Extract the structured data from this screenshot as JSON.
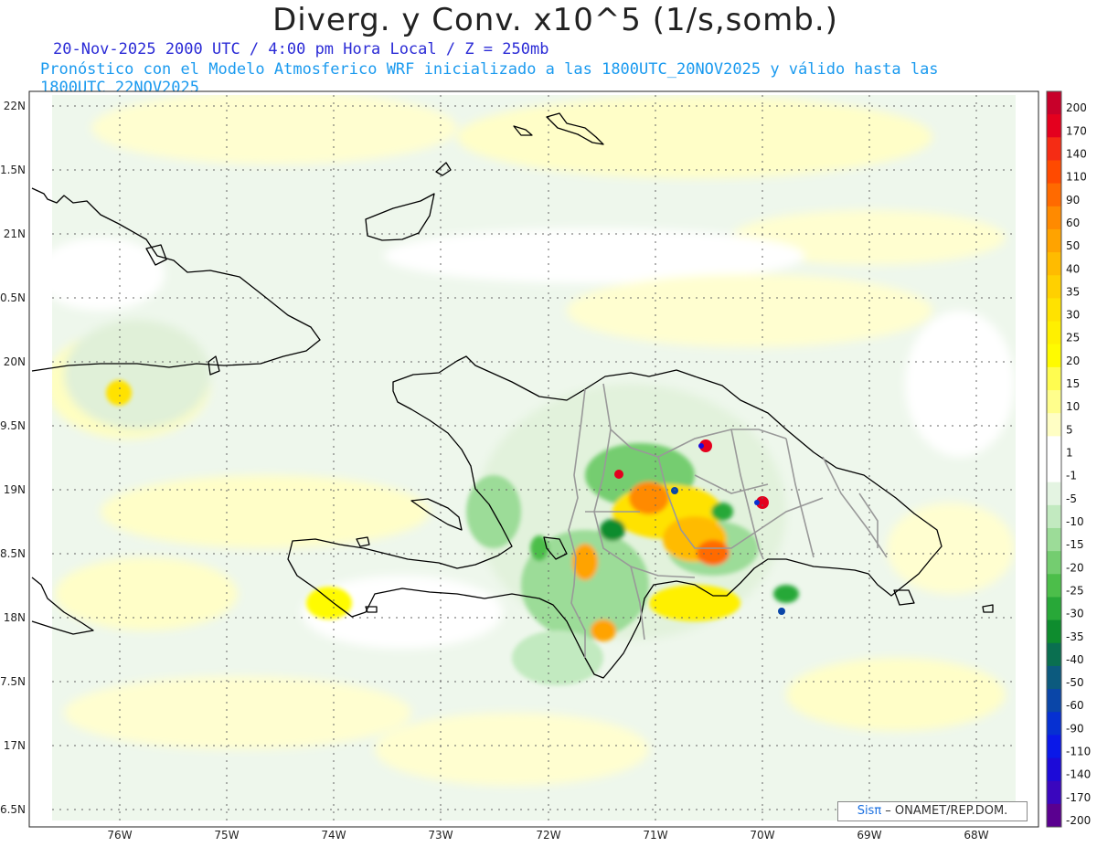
{
  "header": {
    "title": "Diverg. y Conv. x10^5 (1/s,somb.)",
    "subtitle": "20-Nov-2025  2000 UTC / 4:00 pm Hora Local / Z = 250mb",
    "description": "Pronóstico con el Modelo Atmosferico WRF inicializado a las 1800UTC_20NOV2025 y válido hasta las  1800UTC_22NOV2025"
  },
  "axes": {
    "lat_labels": [
      "22N",
      "1.5N",
      "21N",
      "0.5N",
      "20N",
      "9.5N",
      "19N",
      "8.5N",
      "18N",
      "7.5N",
      "17N",
      "6.5N"
    ],
    "lon_labels": [
      "76W",
      "75W",
      "74W",
      "73W",
      "72W",
      "71W",
      "70W",
      "69W",
      "68W"
    ]
  },
  "colorbar": {
    "labels": [
      "200",
      "170",
      "140",
      "110",
      "90",
      "60",
      "50",
      "40",
      "35",
      "30",
      "25",
      "20",
      "15",
      "10",
      "5",
      "1",
      "-1",
      "-5",
      "-10",
      "-15",
      "-20",
      "-25",
      "-30",
      "-35",
      "-40",
      "-50",
      "-60",
      "-90",
      "-110",
      "-140",
      "-170",
      "-200"
    ],
    "colors": [
      "#c8002a",
      "#e4001e",
      "#f52c14",
      "#ff4a00",
      "#ff6a00",
      "#ff8a00",
      "#ffa300",
      "#ffbb00",
      "#ffd000",
      "#ffe200",
      "#fff000",
      "#fffb00",
      "#fffc50",
      "#fffe8c",
      "#fffec4",
      "#ffffff",
      "#ffffff",
      "#e4f4e2",
      "#c2eac0",
      "#9cdc98",
      "#74cd70",
      "#4cbe4a",
      "#28a838",
      "#0e8c2e",
      "#0a6f50",
      "#0c5a7e",
      "#0a46a8",
      "#0630d2",
      "#0a18e8",
      "#1c0ad8",
      "#3a06be",
      "#5a0090"
    ]
  },
  "credit": {
    "brand": "Sisπ",
    "text": " – ONAMET/REP.DOM."
  }
}
